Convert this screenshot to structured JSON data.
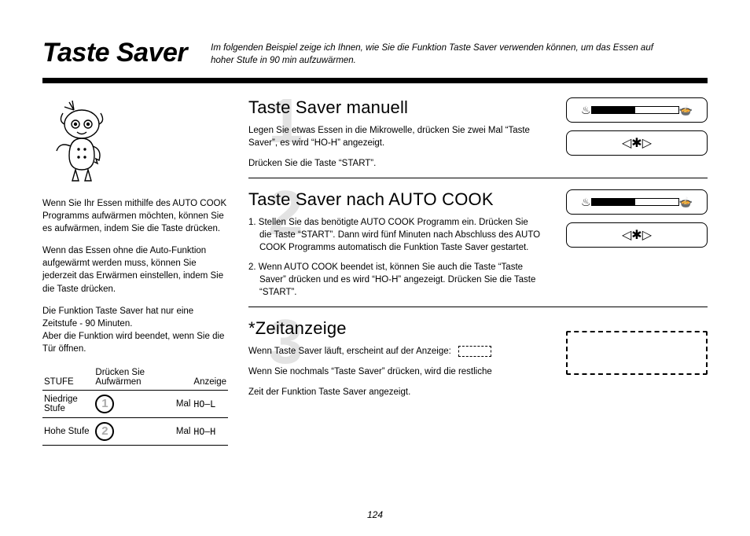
{
  "header": {
    "title": "Taste Saver",
    "intro": "Im folgenden Beispiel zeige ich Ihnen, wie Sie die Funktion Taste Saver verwenden können, um das Essen auf hoher Stufe in 90 min aufzuwärmen."
  },
  "sidebar": {
    "p1": "Wenn Sie Ihr Essen mithilfe des AUTO COOK Programms aufwärmen möchten, können Sie es aufwärmen, indem Sie die Taste drücken.",
    "p2": "Wenn das Essen ohne die Auto-Funktion aufgewärmt werden muss, können Sie jederzeit das Erwärmen einstellen, indem Sie die Taste drücken.",
    "p3": "Die Funktion Taste Saver hat nur eine Zeitstufe - 90 Minuten.",
    "p4": "Aber die Funktion wird beendet, wenn Sie die Tür öffnen.",
    "table": {
      "h1": "STUFE",
      "h2": "Drücken Sie Aufwärmen",
      "h3": "Anzeige",
      "rows": [
        {
          "stufe": "Niedrige Stufe",
          "num": "1",
          "press": "Mal",
          "disp": "HO–L"
        },
        {
          "stufe": "Hohe Stufe",
          "num": "2",
          "press": "Mal",
          "disp": "HO–H"
        }
      ]
    }
  },
  "sections": [
    {
      "bignum": "1",
      "title": "Taste Saver manuell",
      "body1": "Legen Sie etwas Essen in die Mikrowelle, drücken Sie zwei Mal “Taste Saver”, es wird “HO-H” angezeigt.",
      "body2": "Drücken Sie die Taste “START”."
    },
    {
      "bignum": "2",
      "title": "Taste Saver nach AUTO COOK",
      "step1": "1. Stellen Sie das benötigte AUTO COOK Programm ein. Drücken Sie die Taste “START”. Dann wird fünf Minuten nach Abschluss des AUTO COOK Programms automatisch die Funktion Taste Saver gestartet.",
      "step2": "2. Wenn AUTO COOK beendet ist, können Sie auch die Taste “Taste Saver” drücken und es wird “HO-H” angezeigt. Drücken Sie die Taste “START”."
    },
    {
      "bignum": "3",
      "title": "*Zeitanzeige",
      "body1": "Wenn Taste Saver läuft, erscheint auf der Anzeige:",
      "body2": "Wenn Sie nochmals “Taste Saver” drücken, wird die restliche",
      "body3": "Zeit der Funktion Taste Saver angezeigt."
    }
  ],
  "page_number": "124"
}
